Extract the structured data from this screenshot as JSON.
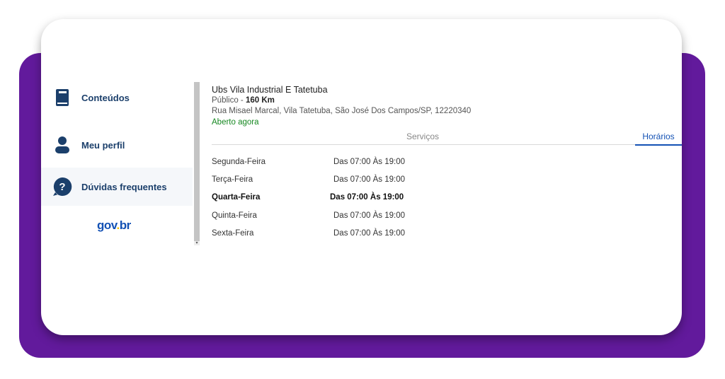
{
  "sidebar": {
    "items": [
      {
        "label": "Conteúdos",
        "icon": "book-icon"
      },
      {
        "label": "Meu perfil",
        "icon": "user-icon"
      },
      {
        "label": "Dúvidas frequentes",
        "icon": "question-icon"
      }
    ],
    "logo": {
      "part1": "gov",
      "dot": ".",
      "part2": "br"
    }
  },
  "unit": {
    "name": "Ubs Vila Industrial E Tatetuba",
    "type_prefix": "Público - ",
    "distance": "160 Km",
    "address": "Rua Misael Marcal, Vila Tatetuba, São José Dos Campos/SP, 12220340",
    "status": "Aberto agora"
  },
  "tabs": {
    "services": "Serviços",
    "hours": "Horários",
    "active": "hours"
  },
  "schedule": [
    {
      "day": "Segunda-Feira",
      "time": "Das 07:00 Às 19:00"
    },
    {
      "day": "Terça-Feira",
      "time": "Das 07:00 Às 19:00"
    },
    {
      "day": "Quarta-Feira",
      "time": "Das 07:00 Às 19:00"
    },
    {
      "day": "Quinta-Feira",
      "time": "Das 07:00 Às 19:00"
    },
    {
      "day": "Sexta-Feira",
      "time": "Das 07:00 Às 19:00"
    }
  ],
  "colors": {
    "purple": "#621a9c",
    "navy": "#1b3f6b",
    "link_blue": "#1351b4",
    "open_green": "#168821"
  }
}
